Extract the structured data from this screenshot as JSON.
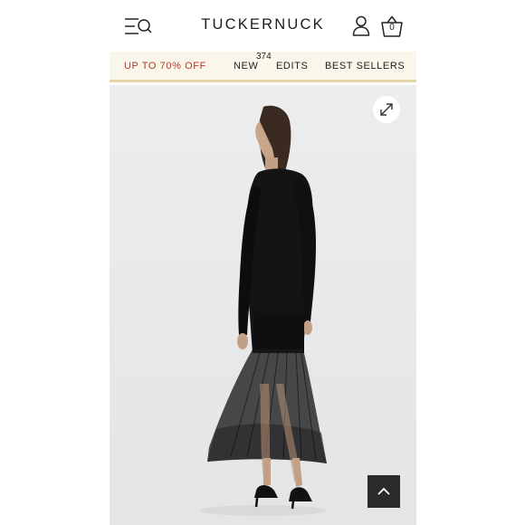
{
  "header": {
    "logo": "TUCKERNUCK",
    "cart_count": "0",
    "icons": {
      "menu": "menu-search-icon",
      "account": "user-icon",
      "cart": "shopping-basket-icon"
    }
  },
  "promo_nav": {
    "items": [
      {
        "label": "UP TO 70% OFF",
        "color": "#b3382c"
      },
      {
        "label": "NEW"
      },
      {
        "label": "EDITS"
      },
      {
        "label": "BEST SELLERS"
      }
    ],
    "new_count": "374",
    "background": "#faf7ea",
    "border_color": "#e6d7a8"
  },
  "product_image": {
    "icons": {
      "expand": "expand-arrows-icon",
      "scroll_top": "chevron-up-icon"
    }
  }
}
